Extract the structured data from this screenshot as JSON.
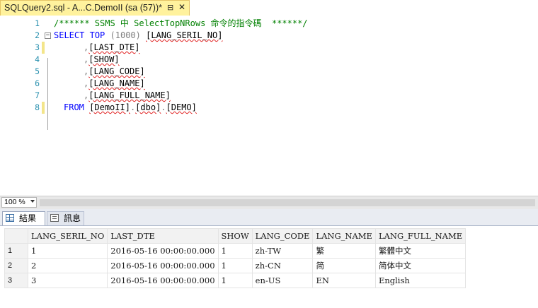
{
  "tab": {
    "title": "SQLQuery2.sql - A...C.DemoII (sa (57))*",
    "pin": "⊟",
    "close": "✕"
  },
  "editor": {
    "lines": [
      {
        "num": "1"
      },
      {
        "num": "2",
        "outline": "−"
      },
      {
        "num": "3"
      },
      {
        "num": "4"
      },
      {
        "num": "5"
      },
      {
        "num": "6"
      },
      {
        "num": "7"
      },
      {
        "num": "8"
      }
    ],
    "comment": "/****** SSMS 中 SelectTopNRows 命令的指令碼  ******/",
    "select_kw": "SELECT",
    "top_kw": "TOP",
    "top_n": "(1000)",
    "from_kw": "FROM",
    "columns": [
      "[LANG_SERIL_NO]",
      "[LAST_DTE]",
      "[SHOW]",
      "[LANG_CODE]",
      "[LANG_NAME]",
      "[LANG_FULL_NAME]"
    ],
    "comma": ",",
    "table_ref": [
      "[DemoII]",
      "[dbo]",
      "[DEMO]"
    ],
    "dot": "."
  },
  "zoom": {
    "value": "100 %"
  },
  "result_tabs": {
    "results": "結果",
    "messages": "訊息"
  },
  "grid": {
    "headers": [
      "LANG_SERIL_NO",
      "LAST_DTE",
      "SHOW",
      "LANG_CODE",
      "LANG_NAME",
      "LANG_FULL_NAME"
    ],
    "rows": [
      {
        "n": "1",
        "cells": [
          "1",
          "2016-05-16 00:00:00.000",
          "1",
          "zh-TW",
          "繁",
          "繁體中文"
        ]
      },
      {
        "n": "2",
        "cells": [
          "2",
          "2016-05-16 00:00:00.000",
          "1",
          "zh-CN",
          "简",
          "简体中文"
        ]
      },
      {
        "n": "3",
        "cells": [
          "3",
          "2016-05-16 00:00:00.000",
          "1",
          "en-US",
          "EN",
          "English"
        ]
      }
    ]
  }
}
